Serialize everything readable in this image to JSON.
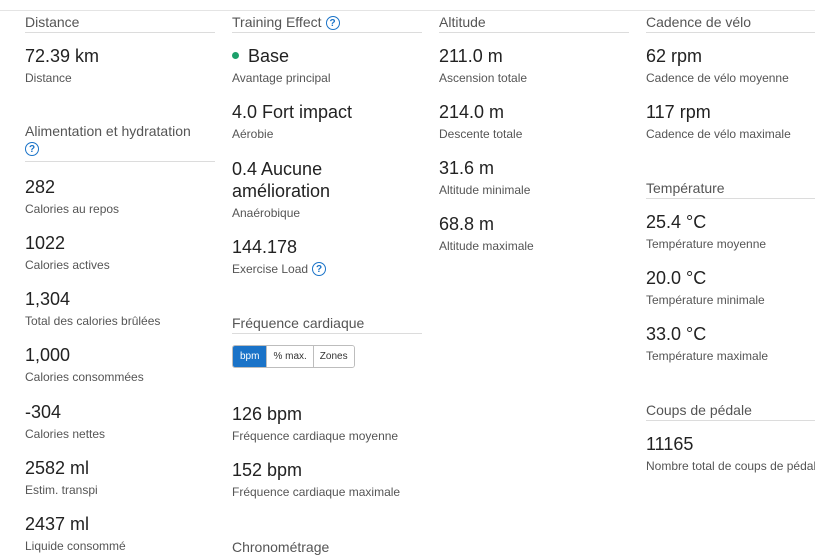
{
  "distance": {
    "header": "Distance",
    "items": [
      {
        "value": "72.39 km",
        "label": "Distance"
      }
    ]
  },
  "nutrition": {
    "header": "Alimentation et hydratation",
    "items": [
      {
        "value": "282",
        "label": "Calories au repos"
      },
      {
        "value": "1022",
        "label": "Calories actives"
      },
      {
        "value": "1,304",
        "label": "Total des calories brûlées"
      },
      {
        "value": "1,000",
        "label": "Calories consommées"
      },
      {
        "value": "-304",
        "label": "Calories nettes"
      },
      {
        "value": "2582 ml",
        "label": "Estim. transpi"
      },
      {
        "value": "2437 ml",
        "label": "Liquide consommé"
      }
    ]
  },
  "training": {
    "header": "Training Effect",
    "items": [
      {
        "value": "Base",
        "label": "Avantage principal"
      },
      {
        "value": "4.0 Fort impact",
        "label": "Aérobie"
      },
      {
        "value_line1": "0.4 Aucune",
        "value_line2": "amélioration",
        "label": "Anaérobique"
      },
      {
        "value": "144.178",
        "label": "Exercise Load"
      }
    ]
  },
  "heart_rate": {
    "header": "Fréquence cardiaque",
    "toggle": [
      "bpm",
      "% max.",
      "Zones"
    ],
    "items": [
      {
        "value": "126 bpm",
        "label": "Fréquence cardiaque moyenne"
      },
      {
        "value": "152 bpm",
        "label": "Fréquence cardiaque maximale"
      }
    ]
  },
  "timing": {
    "header": "Chronométrage"
  },
  "altitude": {
    "header": "Altitude",
    "items": [
      {
        "value": "211.0 m",
        "label": "Ascension totale"
      },
      {
        "value": "214.0 m",
        "label": "Descente totale"
      },
      {
        "value": "31.6 m",
        "label": "Altitude minimale"
      },
      {
        "value": "68.8 m",
        "label": "Altitude maximale"
      }
    ]
  },
  "cadence": {
    "header": "Cadence de vélo",
    "items": [
      {
        "value": "62 rpm",
        "label": "Cadence de vélo moyenne"
      },
      {
        "value": "117 rpm",
        "label": "Cadence de vélo maximale"
      }
    ]
  },
  "temperature": {
    "header": "Température",
    "items": [
      {
        "value": "25.4 °C",
        "label": "Température moyenne"
      },
      {
        "value": "20.0 °C",
        "label": "Température minimale"
      },
      {
        "value": "33.0 °C",
        "label": "Température maximale"
      }
    ]
  },
  "strokes": {
    "header": "Coups de pédale",
    "items": [
      {
        "value": "11165",
        "label": "Nombre total de coups de pédale"
      }
    ]
  },
  "help_glyph": "?",
  "colors": {
    "accent": "#1a73c8",
    "positive_dot": "#1ca06b"
  }
}
